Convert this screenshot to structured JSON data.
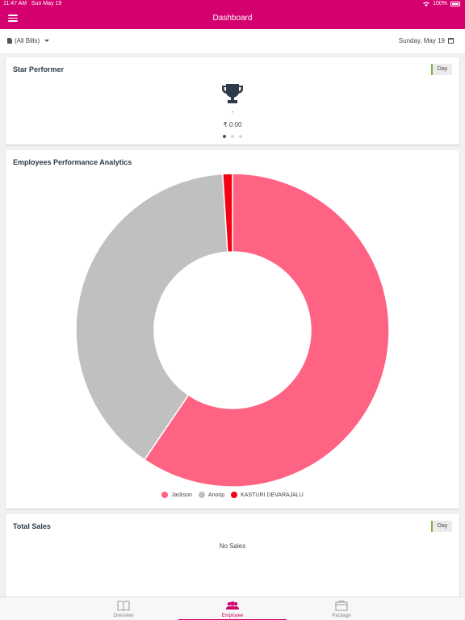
{
  "status_bar": {
    "time": "11:47 AM",
    "date": "Sun May 19",
    "battery": "100%"
  },
  "header": {
    "title": "Dashboard"
  },
  "filter": {
    "bills": "(All Bills)",
    "date": "Sunday, May 19"
  },
  "star_performer": {
    "title": "Star Performer",
    "period": "Day",
    "name": "-",
    "amount": "₹ 0.00",
    "page_count": 3,
    "active_page": 1
  },
  "analytics": {
    "title": "Employees Performance Analytics",
    "chart_data": {
      "type": "pie",
      "series": [
        {
          "name": "Jackson",
          "value": 59.5,
          "color": "#ff6384"
        },
        {
          "name": "Anoop",
          "value": 39.5,
          "color": "#c0c0c0"
        },
        {
          "name": "KASTURI DEVARAJALU",
          "value": 1.0,
          "color": "#f40012"
        }
      ]
    }
  },
  "total_sales": {
    "title": "Total Sales",
    "period": "Day",
    "empty_text": "No Sales"
  },
  "tabs": [
    {
      "label": "Overview",
      "icon": "book-icon",
      "active": false
    },
    {
      "label": "Employee",
      "icon": "people-icon",
      "active": true
    },
    {
      "label": "Package",
      "icon": "package-icon",
      "active": false
    }
  ],
  "colors": {
    "brand": "#d4006f",
    "day_badge_accent": "#7cb342"
  }
}
